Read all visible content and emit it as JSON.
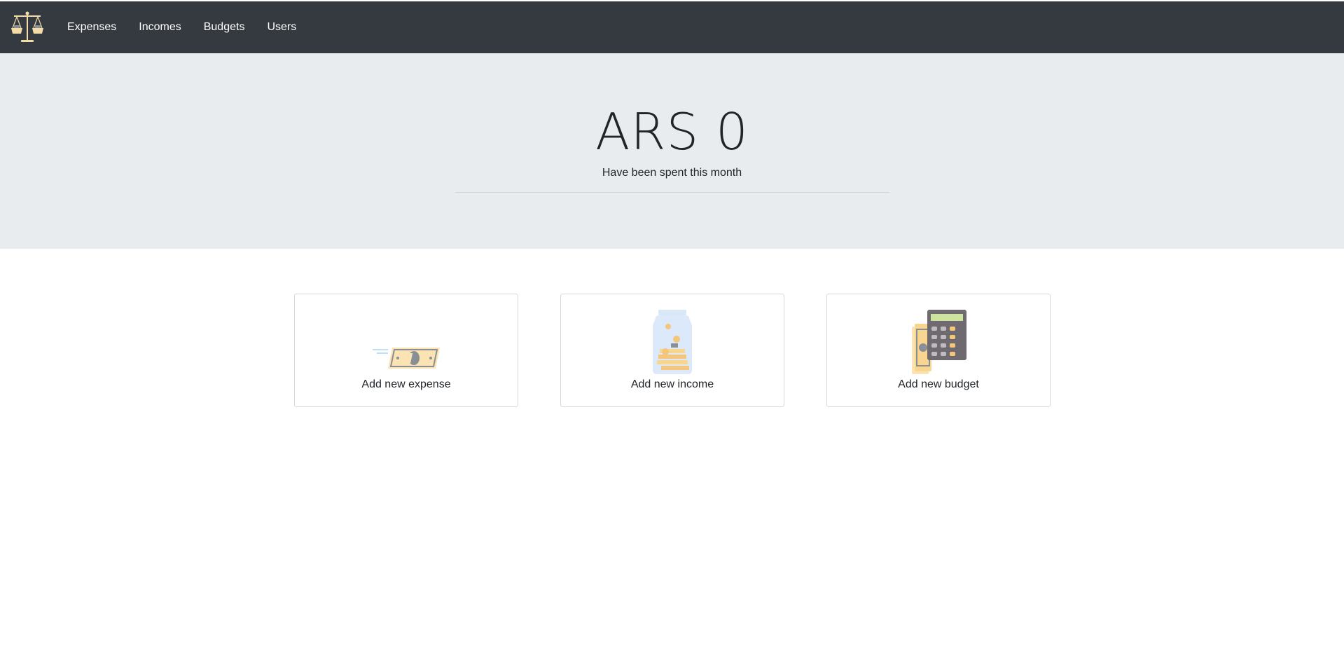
{
  "navbar": {
    "logo_icon": "balance-scale-icon",
    "links": [
      {
        "label": "Expenses"
      },
      {
        "label": "Incomes"
      },
      {
        "label": "Budgets"
      },
      {
        "label": "Users"
      }
    ],
    "colors": {
      "background": "#343a40",
      "text": "#ffffff"
    }
  },
  "summary": {
    "amount": "ARS 0",
    "subtitle": "Have been spent this month",
    "background": "#e9ecef"
  },
  "cards": [
    {
      "label": "Add new expense",
      "icon": "flying-money-icon"
    },
    {
      "label": "Add new income",
      "icon": "coin-jar-icon"
    },
    {
      "label": "Add new budget",
      "icon": "calculator-money-icon"
    }
  ]
}
